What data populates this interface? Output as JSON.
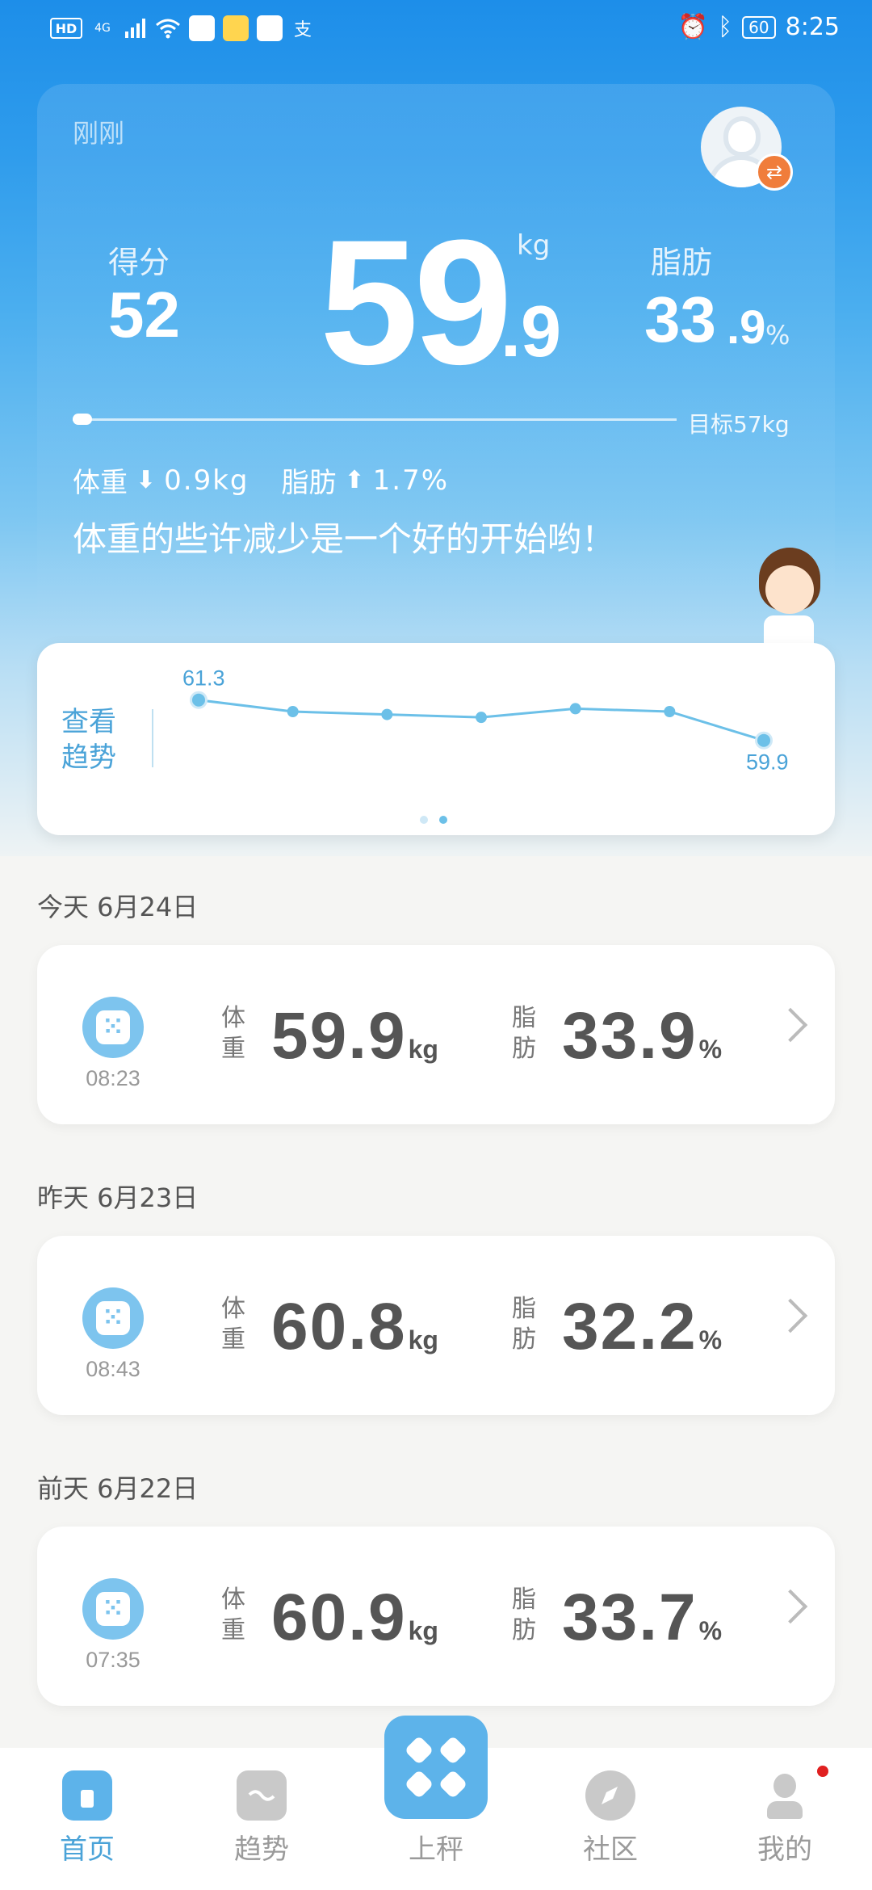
{
  "status_bar": {
    "left_icons": [
      "HD",
      "4G",
      "signal",
      "wifi",
      "app-icon",
      "app-icon",
      "app-icon",
      "alipay"
    ],
    "network": "4G",
    "hd": "HD",
    "alipay_glyph": "支",
    "battery": "60",
    "time": "8:25"
  },
  "summary": {
    "time_label": "刚刚",
    "score_label": "得分",
    "score_value": "52",
    "weight_int": "59",
    "weight_dec": ".9",
    "weight_unit": "kg",
    "fat_label": "脂肪",
    "fat_int": "33",
    "fat_dec": ".9",
    "fat_unit": "%",
    "goal_text": "目标57kg",
    "weight_delta_label": "体重",
    "weight_delta": "0.9kg",
    "weight_delta_direction": "down",
    "fat_delta_label": "脂肪",
    "fat_delta": "1.7%",
    "fat_delta_direction": "up",
    "message": "体重的些许减少是一个好的开始哟！"
  },
  "trend": {
    "link_text": "查看趋势",
    "first_label": "61.3",
    "last_label": "59.9",
    "points": [
      61.3,
      60.9,
      60.8,
      60.7,
      61.0,
      60.9,
      59.9
    ],
    "y_range": [
      59.5,
      61.6
    ],
    "page_count": 2,
    "active_page": 2
  },
  "records": [
    {
      "day_label": "今天 6月24日",
      "time": "08:23",
      "weight_label": "体重",
      "weight": "59.9",
      "weight_unit": "kg",
      "fat_label": "脂肪",
      "fat": "33.9",
      "fat_unit": "%"
    },
    {
      "day_label": "昨天 6月23日",
      "time": "08:43",
      "weight_label": "体重",
      "weight": "60.8",
      "weight_unit": "kg",
      "fat_label": "脂肪",
      "fat": "32.2",
      "fat_unit": "%"
    },
    {
      "day_label": "前天 6月22日",
      "time": "07:35",
      "weight_label": "体重",
      "weight": "60.9",
      "weight_unit": "kg",
      "fat_label": "脂肪",
      "fat": "33.7",
      "fat_unit": "%"
    }
  ],
  "nav": {
    "home": "首页",
    "trend": "趋势",
    "weigh": "上秤",
    "community": "社区",
    "mine": "我的",
    "active": "home",
    "accent": "#4aa3d8"
  },
  "colors": {
    "hero_top": "#1d8ee9",
    "accent": "#5db3ea",
    "badge": "#f07d3b",
    "notify": "#e02020"
  }
}
